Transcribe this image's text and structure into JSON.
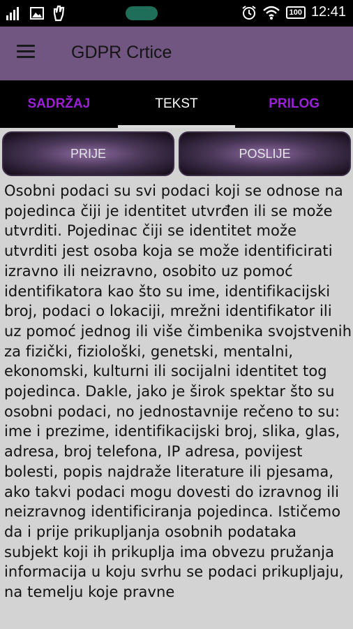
{
  "status_bar": {
    "time": "12:41",
    "battery": "100",
    "icons": [
      "signal-icon",
      "image-icon",
      "hand-icon",
      "alarm-icon",
      "wifi-icon",
      "battery-icon"
    ]
  },
  "app_bar": {
    "title": "GDPR Crtice",
    "menu_icon": "hamburger-menu-icon"
  },
  "tabs": [
    {
      "label": "SADRŽAJ",
      "active": false
    },
    {
      "label": "TEKST",
      "active": true
    },
    {
      "label": "PRILOG",
      "active": false
    }
  ],
  "nav_buttons": {
    "prev_label": "PRIJE",
    "next_label": "POSLIJE"
  },
  "body_text": "Osobni podaci su svi podaci koji se odnose na pojedinca čiji je identitet utvrđen ili se može utvrditi. Pojedinac čiji se identitet može utvrditi jest osoba koja se može identificirati izravno ili neizravno, osobito uz pomoć identifikatora kao što su ime, identifikacijski broj, podaci o lokaciji, mrežni identifikator ili uz pomoć jednog ili više čimbenika svojstvenih za fizički, fiziološki, genetski, mentalni, ekonomski, kulturni ili socijalni identitet tog pojedinca. Dakle, jako je širok spektar što su osobni podaci, no jednostavnije rečeno to su: ime i prezime, identifikacijski broj, slika, glas, adresa, broj telefona, IP adresa, povijest bolesti, popis najdraže literature ili pjesama, ako takvi podaci mogu dovesti do izravnog ili neizravnog identificiranja pojedinca. Ističemo da i prije prikupljanja osobnih podataka subjekt koji ih prikuplja ima obvezu pružanja informacija u koju svrhu se podaci prikupljaju, na temelju koje pravne",
  "colors": {
    "app_bar": "#705680",
    "tab_accent": "#9a1fd6",
    "content_bg": "#d3d3d3"
  }
}
